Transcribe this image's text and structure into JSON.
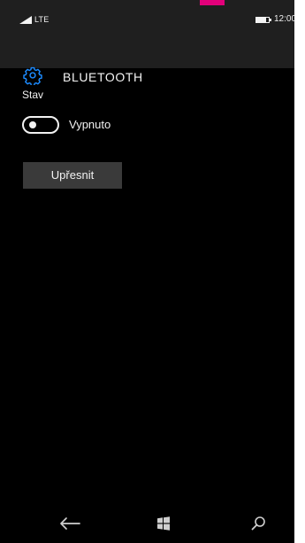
{
  "status_bar": {
    "network": "LTE",
    "time": "12:00",
    "icons": {
      "signal": "signal-icon",
      "battery": "battery-icon"
    }
  },
  "header": {
    "icon": "gear-icon",
    "title": "BLUETOOTH"
  },
  "bluetooth": {
    "status_label": "Stav",
    "toggle_state": "Vypnuto",
    "refine_label": "Upřesnit"
  },
  "navigation": {
    "back_icon": "back-arrow-icon",
    "home_icon": "windows-logo-icon",
    "search_icon": "search-icon"
  },
  "colors": {
    "background": "#000000",
    "status_bar": "#1f1f1f",
    "accent": "#1c8bff",
    "brand_accent": "#e2007a",
    "text": "#f2f2f2",
    "button": "#3a3a3a"
  }
}
